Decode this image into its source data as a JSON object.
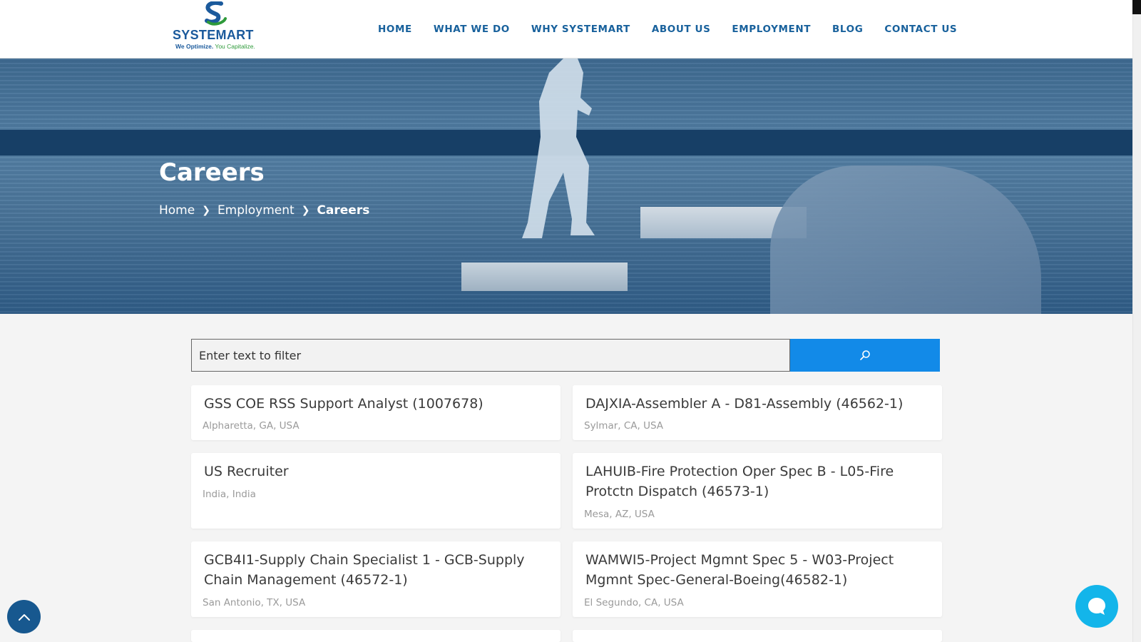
{
  "brand": {
    "name": "SYSTEMART",
    "tagline_left": "We Optimize.",
    "tagline_right": " You Capitalize.",
    "primary_color": "#1b5a9c",
    "accent_color": "#2e9a3a"
  },
  "nav": {
    "items": [
      {
        "label": "HOME"
      },
      {
        "label": "WHAT WE DO"
      },
      {
        "label": "WHY SYSTEMART"
      },
      {
        "label": "ABOUT US"
      },
      {
        "label": "EMPLOYMENT"
      },
      {
        "label": "BLOG"
      },
      {
        "label": "CONTACT US"
      }
    ]
  },
  "hero": {
    "title": "Careers",
    "breadcrumb": [
      "Home",
      "Employment",
      "Careers"
    ],
    "separator_icon": "chevron-right-icon"
  },
  "search": {
    "placeholder": "Enter text to filter",
    "button_icon": "search-icon",
    "button_color": "#128ae8"
  },
  "jobs": [
    {
      "title": "GSS COE RSS Support Analyst (1007678)",
      "location": "Alpharetta, GA, USA"
    },
    {
      "title": "DAJXIA-Assembler A - D81-Assembly (46562-1)",
      "location": "Sylmar, CA, USA"
    },
    {
      "title": "US Recruiter",
      "location": "India, India"
    },
    {
      "title": "LAHUIB-Fire Protection Oper Spec B - L05-Fire Protctn Dispatch (46573-1)",
      "location": "Mesa, AZ, USA"
    },
    {
      "title": "GCB4I1-Supply Chain Specialist 1 - GCB-Supply Chain Management (46572-1)",
      "location": "San Antonio, TX, USA"
    },
    {
      "title": "WAMWI5-Project Mgmnt Spec 5 - W03-Project Mgmnt Spec-General-Boeing(46582-1)",
      "location": "El Segundo, CA, USA"
    }
  ],
  "floating": {
    "scroll_top_icon": "chevron-up-icon",
    "chat_icon": "chat-bubble-icon"
  }
}
